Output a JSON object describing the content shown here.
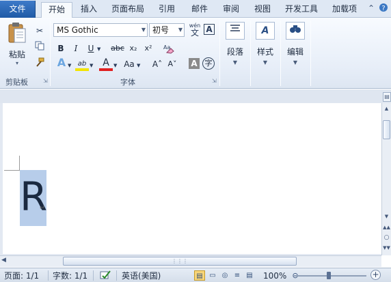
{
  "tabs": {
    "file": "文件",
    "home": "开始",
    "insert": "插入",
    "page_layout": "页面布局",
    "references": "引用",
    "mailings": "邮件",
    "review": "审阅",
    "view": "视图",
    "developer": "开发工具",
    "addins": "加载项"
  },
  "clipboard": {
    "paste_label": "粘贴",
    "group_label": "剪贴板"
  },
  "font": {
    "font_name": "MS Gothic",
    "font_size": "初号",
    "group_label": "字体",
    "bold": "B",
    "italic": "I",
    "underline": "U",
    "strikethrough": "abc",
    "subscript": "x₂",
    "superscript": "x²",
    "grow": "A˄",
    "shrink": "A˅",
    "change_case": "Aa",
    "font_color": "A",
    "highlight": "ab",
    "char_border": "A",
    "enclose": "字",
    "phonetic_top": "wén",
    "phonetic_bottom": "文"
  },
  "paragraph": {
    "label": "段落"
  },
  "styles": {
    "label": "样式"
  },
  "editing": {
    "label": "编辑"
  },
  "document": {
    "text": "R",
    "para_mark": "↵"
  },
  "status": {
    "page": "页面: 1/1",
    "words": "字数: 1/1",
    "language": "英语(美国)",
    "zoom": "100%",
    "zoom_level_percent": 100
  },
  "colors": {
    "file_tab": "#2b66b4",
    "selection": "#b7cdea",
    "ribbon": "#e7eef8"
  }
}
